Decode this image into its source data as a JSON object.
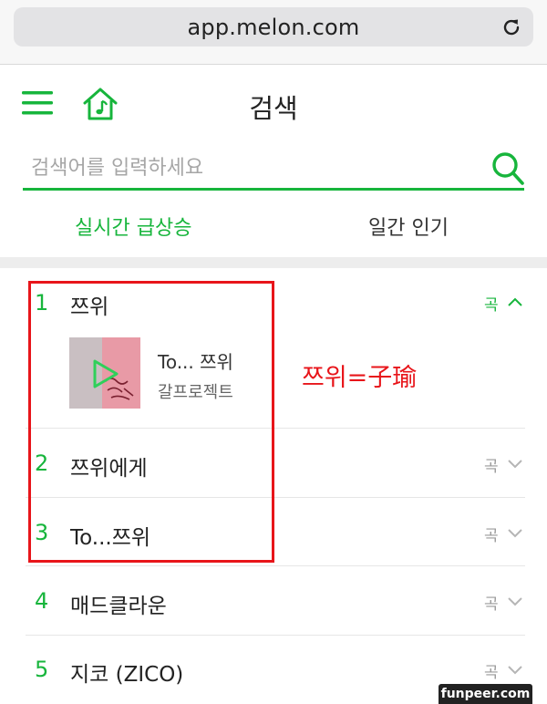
{
  "browser": {
    "url": "app.melon.com",
    "reload_icon": "reload-icon"
  },
  "header": {
    "title": "검색",
    "menu_icon": "hamburger-menu-icon",
    "home_icon": "melon-home-icon"
  },
  "search": {
    "placeholder": "검색어를 입력하세요",
    "value": "",
    "icon": "search-icon"
  },
  "tabs": [
    {
      "label": "실시간 급상승",
      "active": true
    },
    {
      "label": "일간 인기",
      "active": false
    }
  ],
  "results": [
    {
      "rank": "1",
      "keyword": "쯔위",
      "type": "곡",
      "expanded": true,
      "song": {
        "title": "To... 쯔위",
        "artist": "갈프로젝트"
      }
    },
    {
      "rank": "2",
      "keyword": "쯔위에게",
      "type": "곡",
      "expanded": false
    },
    {
      "rank": "3",
      "keyword": "To...쯔위",
      "type": "곡",
      "expanded": false
    },
    {
      "rank": "4",
      "keyword": "매드클라운",
      "type": "곡",
      "expanded": false
    },
    {
      "rank": "5",
      "keyword": "지코 (ZICO)",
      "type": "곡",
      "expanded": false
    }
  ],
  "annotation": {
    "text": "쯔위=子瑜"
  },
  "watermark": {
    "text": "funpeer.com"
  },
  "colors": {
    "accent_green": "#17b53c",
    "annotation_red": "#e8151a",
    "muted_gray": "#9a9a9a"
  }
}
